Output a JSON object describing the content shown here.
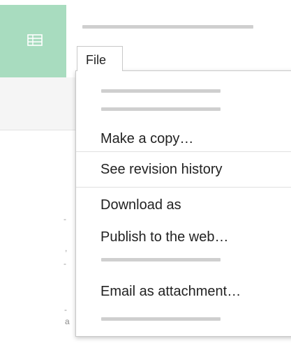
{
  "menu": {
    "tab_label": "File",
    "items": [
      {
        "label": "Make a copy…"
      },
      {
        "label": "See revision history"
      },
      {
        "label": "Download as"
      },
      {
        "label": "Publish to the web…"
      },
      {
        "label": "Email as attachment…"
      }
    ]
  },
  "background_text": {
    "char_a": "a"
  },
  "colors": {
    "app_tile": "#a8dcbf",
    "placeholder_bar": "#cfcfcf",
    "menu_border": "#c8c8c8",
    "text": "#222222"
  },
  "icons": {
    "app_icon": "spreadsheet-grid-icon"
  }
}
